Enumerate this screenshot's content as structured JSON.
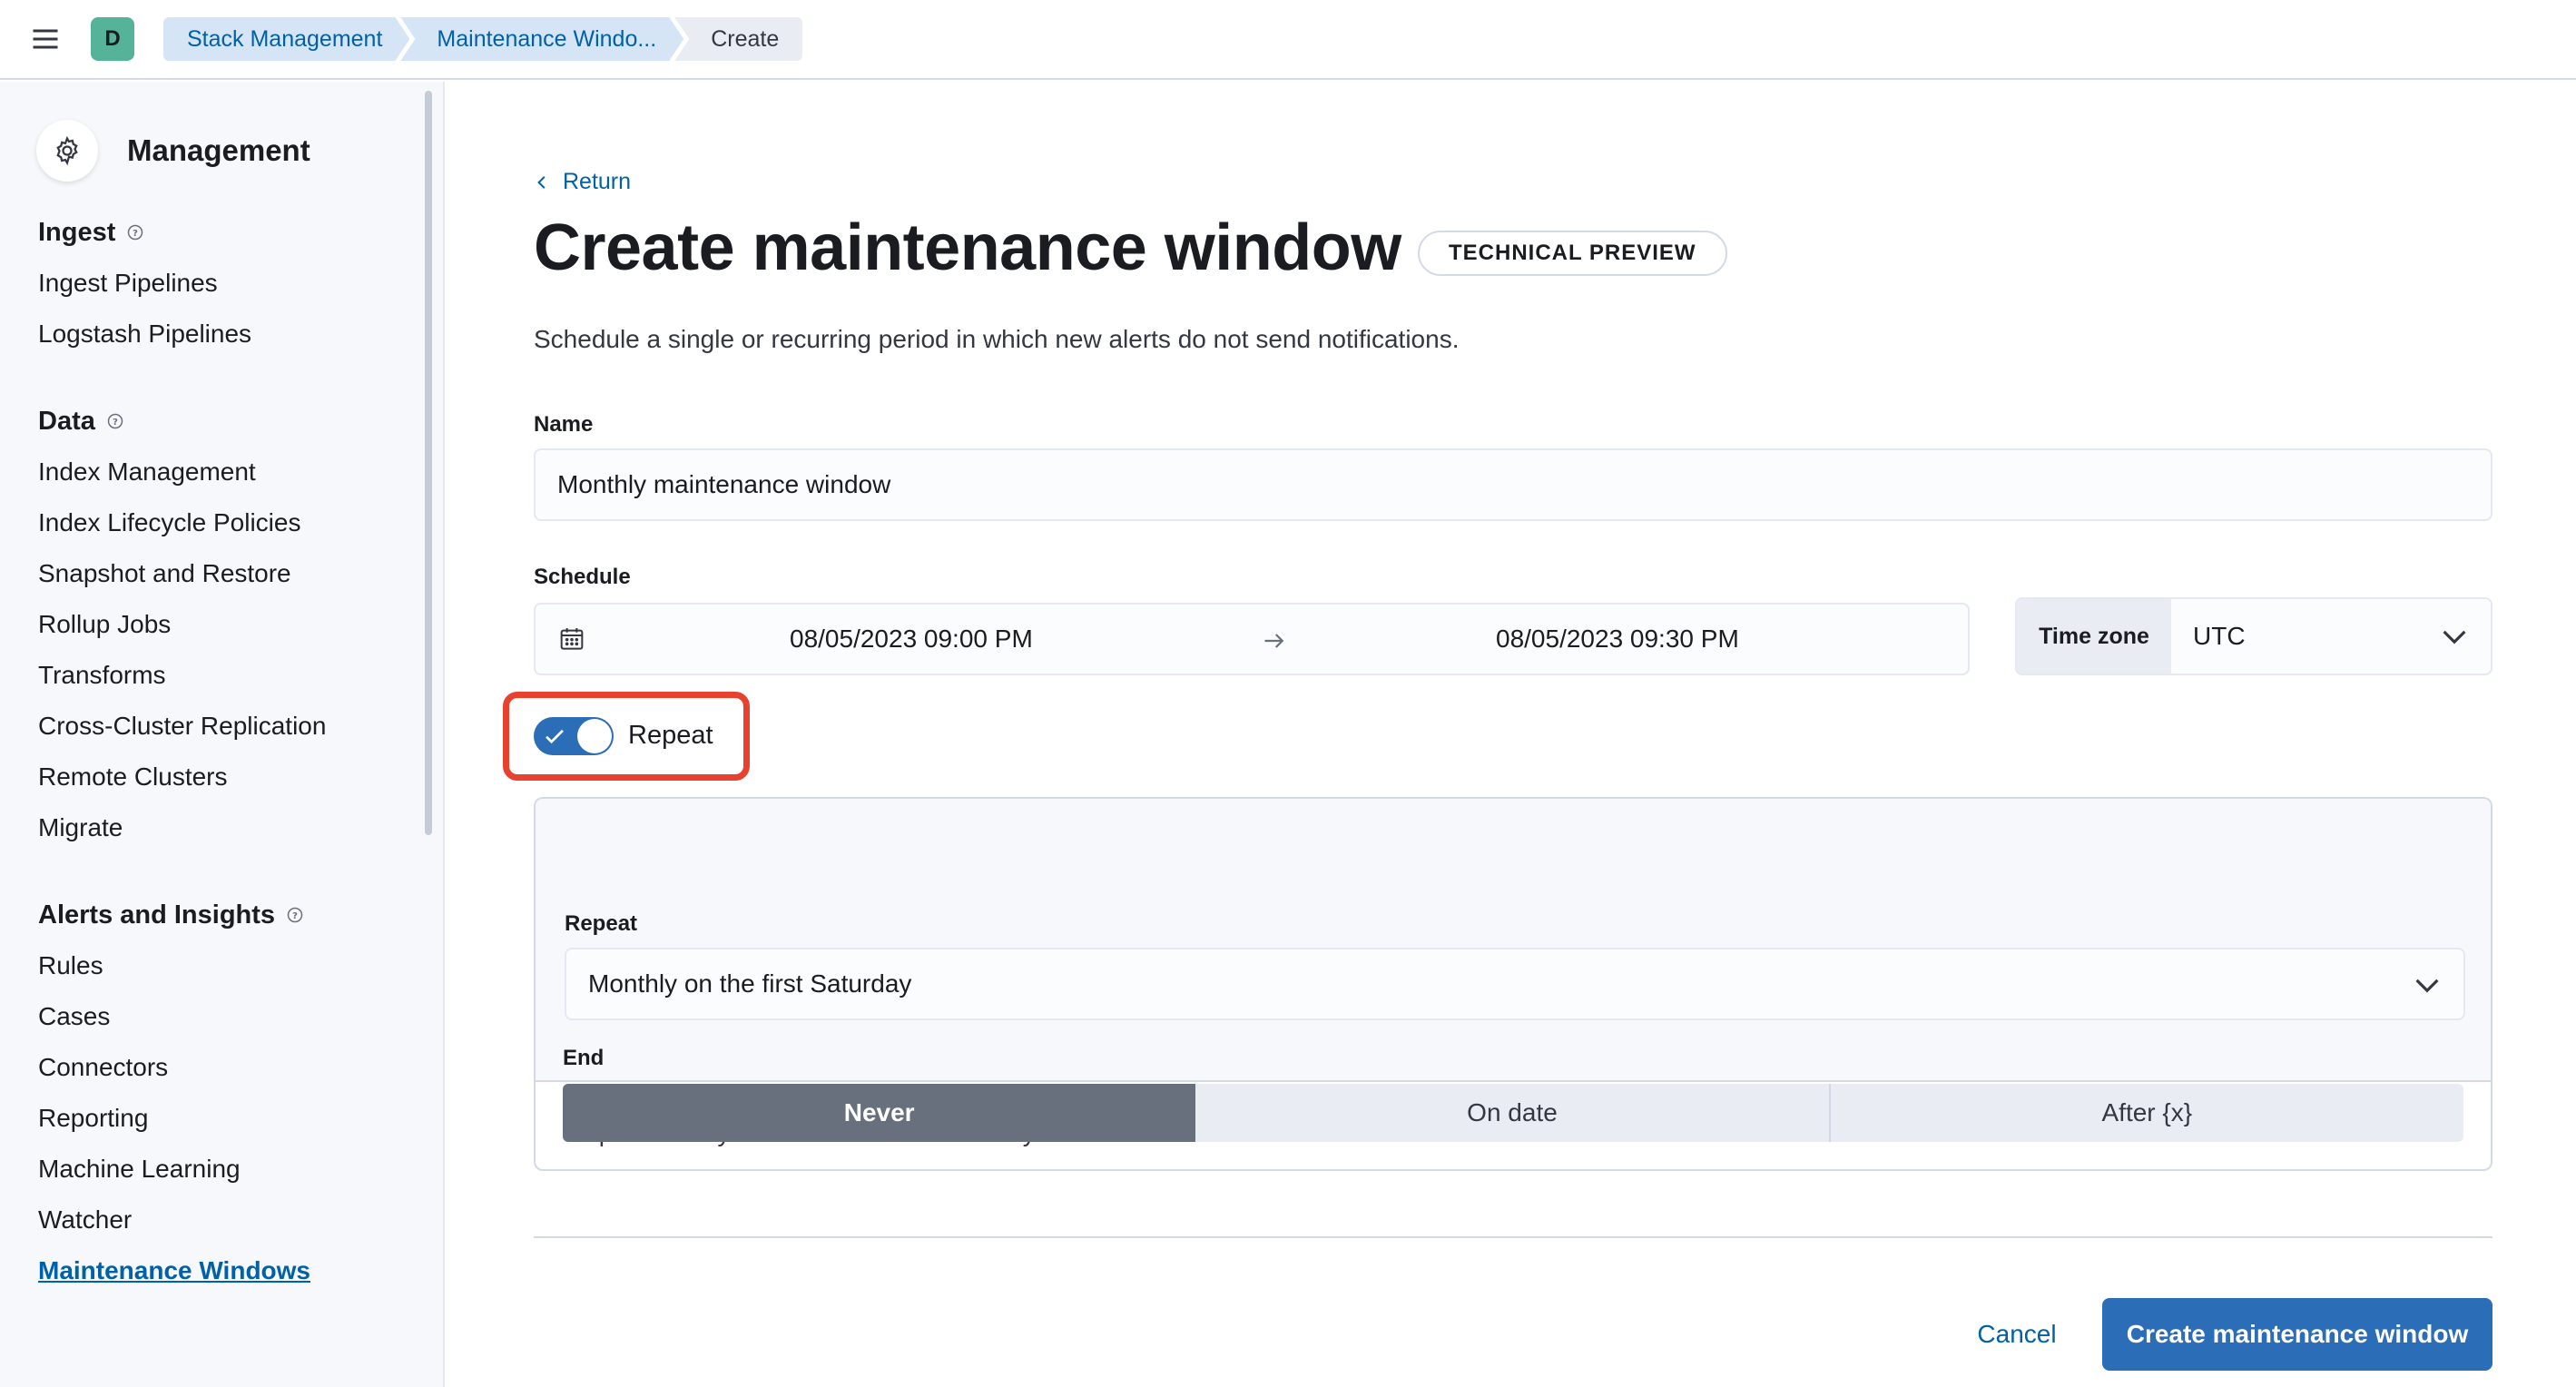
{
  "header": {
    "space_initial": "D",
    "breadcrumbs": [
      "Stack Management",
      "Maintenance Windo...",
      "Create"
    ]
  },
  "sidebar": {
    "title": "Management",
    "groups": [
      {
        "title": "Ingest",
        "items": [
          "Ingest Pipelines",
          "Logstash Pipelines"
        ]
      },
      {
        "title": "Data",
        "items": [
          "Index Management",
          "Index Lifecycle Policies",
          "Snapshot and Restore",
          "Rollup Jobs",
          "Transforms",
          "Cross-Cluster Replication",
          "Remote Clusters",
          "Migrate"
        ]
      },
      {
        "title": "Alerts and Insights",
        "items": [
          "Rules",
          "Cases",
          "Connectors",
          "Reporting",
          "Machine Learning",
          "Watcher",
          "Maintenance Windows"
        ]
      }
    ],
    "active_item": "Maintenance Windows"
  },
  "main": {
    "return_label": "Return",
    "title": "Create maintenance window",
    "badge": "TECHNICAL PREVIEW",
    "subtitle": "Schedule a single or recurring period in which new alerts do not send notifications.",
    "name_label": "Name",
    "name_value": "Monthly maintenance window",
    "schedule_label": "Schedule",
    "start": "08/05/2023 09:00 PM",
    "end": "08/05/2023 09:30 PM",
    "timezone_label": "Time zone",
    "timezone_value": "UTC",
    "repeat_toggle_label": "Repeat",
    "repeat_toggle_on": true,
    "repeat_label": "Repeat",
    "repeat_value": "Monthly on the first Saturday",
    "end_label": "End",
    "end_options": [
      "Never",
      "On date",
      "After {x}"
    ],
    "end_selected": "Never",
    "summary": "Repeats every month on the 1st Saturday",
    "cancel_label": "Cancel",
    "submit_label": "Create maintenance window"
  },
  "colors": {
    "primary": "#2c6db8",
    "link": "#0061a6",
    "highlight": "#e8412e",
    "space_avatar": "#54b399"
  }
}
